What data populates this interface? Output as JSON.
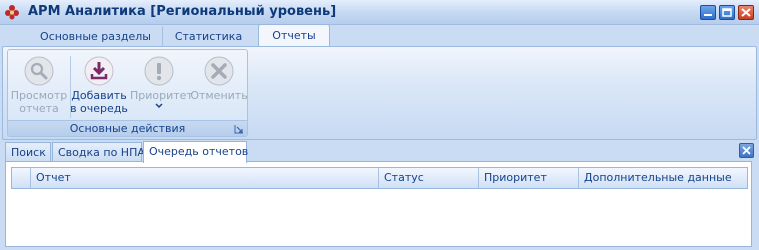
{
  "window": {
    "title": "АРМ Аналитика [Региональный уровень]",
    "icons": [
      "app-flower-icon",
      "minimize-icon",
      "maximize-icon",
      "close-icon"
    ]
  },
  "ribbon_tabs": [
    {
      "label": "Основные разделы",
      "active": false
    },
    {
      "label": "Статистика",
      "active": false
    },
    {
      "label": "Отчеты",
      "active": true
    }
  ],
  "ribbon_group": {
    "label": "Основные действия",
    "buttons": [
      {
        "line1": "Просмотр",
        "line2": "отчета",
        "icon": "magnifier-icon",
        "enabled": false
      },
      {
        "line1": "Добавить",
        "line2": "в очередь",
        "icon": "download-icon",
        "enabled": true
      },
      {
        "line1": "Приоритет",
        "line2": "",
        "icon": "exclamation-icon",
        "enabled": false,
        "dropdown": true
      },
      {
        "line1": "Отменить",
        "line2": "",
        "icon": "cancel-x-icon",
        "enabled": false
      }
    ]
  },
  "doc_tabs": [
    {
      "label": "Поиск",
      "active": false
    },
    {
      "label": "Сводка по НПА",
      "active": false
    },
    {
      "label": "Очередь отчетов",
      "active": true
    }
  ],
  "grid": {
    "columns": [
      "Отчет",
      "Статус",
      "Приоритет",
      "Дополнительные данные"
    ],
    "rows": []
  },
  "colors": {
    "accent": "#15428b",
    "ribbon_bg": "#dbe7f7",
    "close_red": "#c83f24"
  }
}
